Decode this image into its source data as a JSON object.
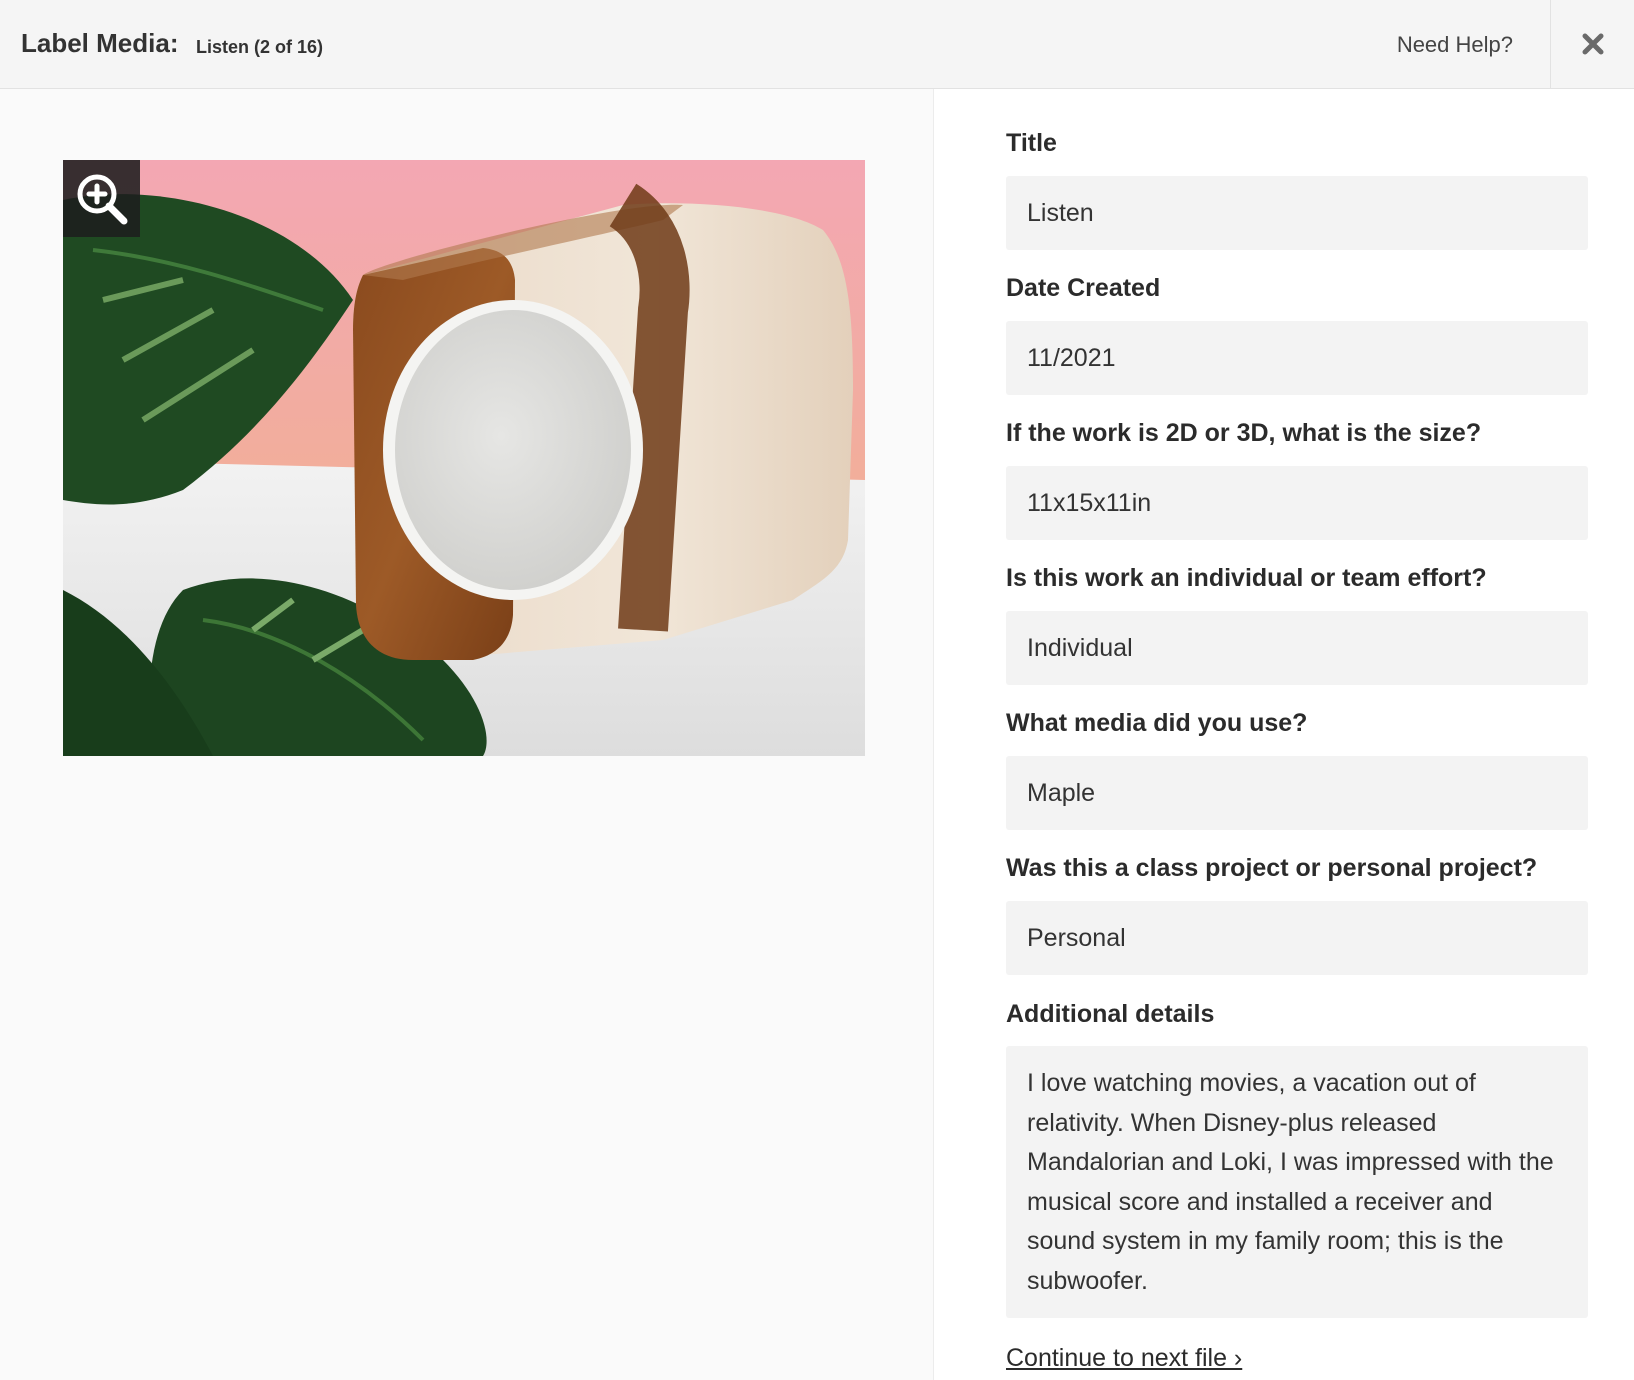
{
  "header": {
    "title": "Label Media:",
    "subtitle": "Listen (2 of 16)",
    "help_label": "Need Help?",
    "close_icon": "close-icon"
  },
  "media": {
    "zoom_icon": "zoom-in-icon",
    "image_subject": "wooden-speaker-photo"
  },
  "form": {
    "fields": [
      {
        "label": "Title",
        "value": "Listen"
      },
      {
        "label": "Date Created",
        "value": "11/2021"
      },
      {
        "label": "If the work is 2D or 3D, what is the size?",
        "value": "11x15x11in"
      },
      {
        "label": "Is this work an individual or team effort?",
        "value": "Individual"
      },
      {
        "label": "What media did you use?",
        "value": "Maple"
      },
      {
        "label": "Was this a class project or personal project?",
        "value": "Personal"
      }
    ],
    "details": {
      "label": "Additional details",
      "value": "I love watching movies, a vacation out of relativity. When Disney-plus released Mandalorian and Loki, I was impressed with the musical score and installed a receiver and sound system in my family room; this is the subwoofer."
    },
    "continue_label": "Continue to next file ›"
  },
  "colors": {
    "header_bg": "#f5f5f5",
    "input_bg": "#f3f3f3",
    "text": "#2b2b2b"
  }
}
